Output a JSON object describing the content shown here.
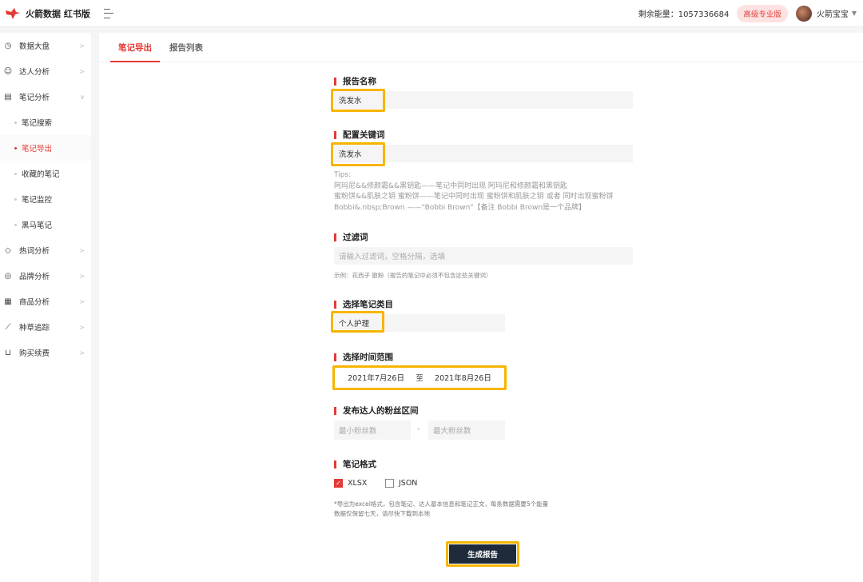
{
  "app": {
    "title": "火箭数据 红书版"
  },
  "header": {
    "energy_label": "剩余能量：1057336684",
    "plan_badge": "高级专业版",
    "username": "火箭宝宝",
    "caret": "▼"
  },
  "sidebar": {
    "items": [
      {
        "label": "数据大盘",
        "icon": "clock-icon",
        "arrow": ">"
      },
      {
        "label": "达人分析",
        "icon": "users-icon",
        "arrow": ">"
      },
      {
        "label": "笔记分析",
        "icon": "note-icon",
        "arrow": "∨"
      }
    ],
    "sub_items": [
      {
        "label": "笔记搜索"
      },
      {
        "label": "笔记导出",
        "active": true
      },
      {
        "label": "收藏的笔记"
      },
      {
        "label": "笔记监控"
      },
      {
        "label": "黑马笔记"
      }
    ],
    "items2": [
      {
        "label": "热词分析",
        "icon": "tag-icon",
        "arrow": ">"
      },
      {
        "label": "品牌分析",
        "icon": "brand-icon",
        "arrow": ">"
      },
      {
        "label": "商品分析",
        "icon": "goods-icon",
        "arrow": ">"
      },
      {
        "label": "种草追踪",
        "icon": "trend-icon",
        "arrow": ">"
      },
      {
        "label": "购买续费",
        "icon": "cart-icon",
        "arrow": ">"
      }
    ]
  },
  "tabs": [
    {
      "label": "笔记导出",
      "active": true
    },
    {
      "label": "报告列表",
      "active": false
    }
  ],
  "form": {
    "report_name": {
      "title": "报告名称",
      "value": "洗发水"
    },
    "keywords": {
      "title": "配置关键词",
      "value": "洗发水"
    },
    "tips": [
      "Tips:",
      "阿玛尼&&修颜霜&&黑钥匙——笔记中同时出现 阿玛尼和修颜霜和黑钥匙",
      "蜜粉饼&&肌肤之钥 蜜粉饼——笔记中同时出现 蜜粉饼和肌肤之钥 或者 同时出现蜜粉饼",
      "Bobbi&.nbsp;Brown ——\"Bobbi Brown\"【备注 Bobbi Brown是一个品牌】"
    ],
    "filter": {
      "title": "过滤词",
      "placeholder": "请输入过滤词，空格分隔，选填",
      "hint": "示例：花西子 散粉（报告的笔记中必须不包含这些关键词）"
    },
    "category": {
      "title": "选择笔记类目",
      "value": "个人护理"
    },
    "time_range": {
      "title": "选择时间范围",
      "start": "2021年7月26日",
      "separator": "至",
      "end": "2021年8月26日"
    },
    "fans": {
      "title": "发布达人的粉丝区间",
      "min_placeholder": "最小粉丝数",
      "dash": "-",
      "max_placeholder": "最大粉丝数"
    },
    "format": {
      "title": "笔记格式",
      "options": [
        {
          "label": "XLSX",
          "checked": true
        },
        {
          "label": "JSON",
          "checked": false
        }
      ],
      "note_lines": [
        "*导出为excel格式，包含笔记、达人基本信息和笔记正文，每条数据需要5个能量",
        "数据仅保留七天，请尽快下载到本地"
      ]
    },
    "submit_label": "生成报告"
  },
  "colors": {
    "accent": "#e53935",
    "highlight": "#f7b500",
    "button": "#1f2b3b"
  }
}
